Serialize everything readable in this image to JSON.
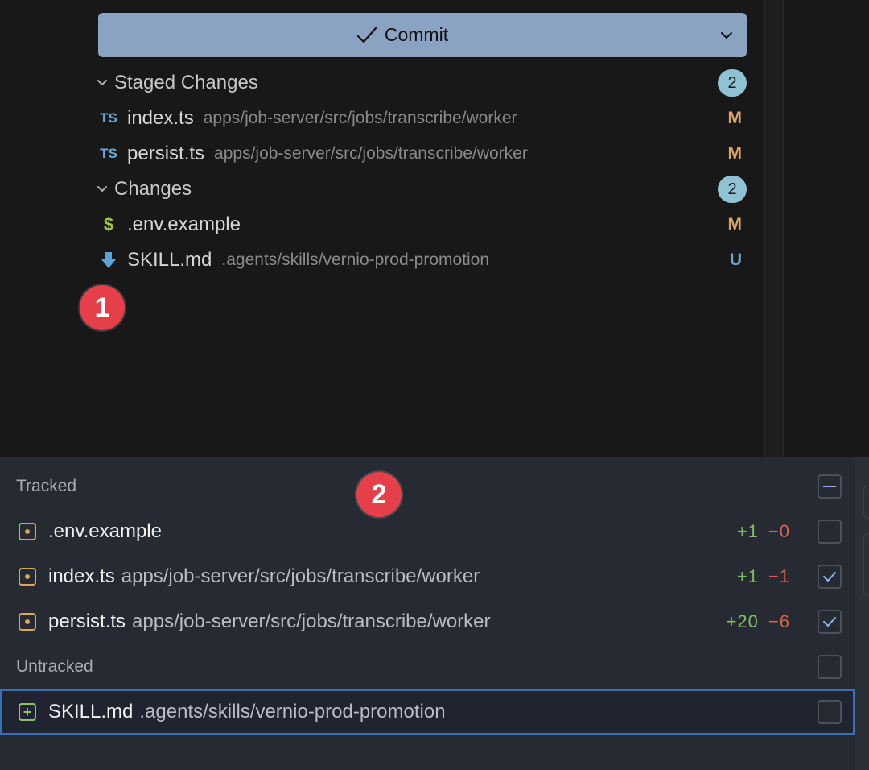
{
  "commit": {
    "label": "Commit"
  },
  "staged": {
    "title": "Staged Changes",
    "count": "2",
    "files": [
      {
        "icon": "TS",
        "name": "index.ts",
        "path": "apps/job-server/src/jobs/transcribe/worker",
        "status": "M"
      },
      {
        "icon": "TS",
        "name": "persist.ts",
        "path": "apps/job-server/src/jobs/transcribe/worker",
        "status": "M"
      }
    ]
  },
  "changes": {
    "title": "Changes",
    "count": "2",
    "files": [
      {
        "icon": "$",
        "name": ".env.example",
        "path": "",
        "status": "M"
      },
      {
        "icon": "download-arrow",
        "name": "SKILL.md",
        "path": ".agents/skills/vernio-prod-promotion",
        "status": "U"
      }
    ]
  },
  "markers": [
    "1",
    "2"
  ],
  "panel": {
    "tracked_label": "Tracked",
    "untracked_label": "Untracked",
    "tracked": [
      {
        "name": ".env.example",
        "path": "",
        "added": "+1",
        "removed": "−0",
        "checked": false
      },
      {
        "name": "index.ts",
        "path": "apps/job-server/src/jobs/transcribe/worker",
        "added": "+1",
        "removed": "−1",
        "checked": true
      },
      {
        "name": "persist.ts",
        "path": "apps/job-server/src/jobs/transcribe/worker",
        "added": "+20",
        "removed": "−6",
        "checked": true
      }
    ],
    "untracked": [
      {
        "name": "SKILL.md",
        "path": ".agents/skills/vernio-prod-promotion",
        "checked": false
      }
    ]
  },
  "colors": {
    "commit_button": "#8aa3c2",
    "badge": "#8fc3d4",
    "status_modified": "#d7a36a",
    "status_untracked": "#6ea7c6",
    "marker": "#e5404a",
    "added": "#7fbf5f",
    "removed": "#d9624e",
    "selection": "#3b6fb5"
  }
}
